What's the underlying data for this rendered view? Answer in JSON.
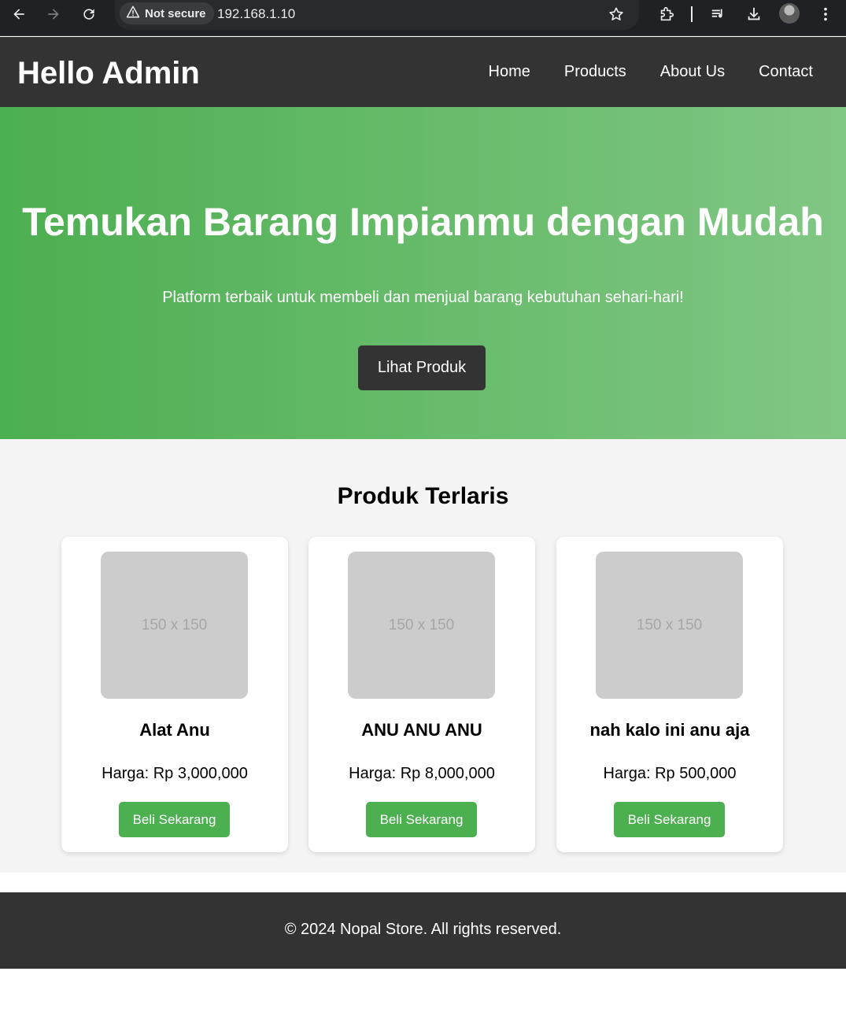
{
  "browser": {
    "security_label": "Not secure",
    "url": "192.168.1.10",
    "icons": [
      "back-arrow-icon",
      "forward-arrow-icon",
      "reload-icon",
      "warning-icon",
      "bookmark-star-icon",
      "extensions-icon",
      "media-playlist-icon",
      "download-icon",
      "profile-avatar",
      "more-vert-icon"
    ]
  },
  "header": {
    "brand": "Hello Admin",
    "nav": [
      "Home",
      "Products",
      "About Us",
      "Contact"
    ]
  },
  "hero": {
    "title": "Temukan Barang Impianmu dengan Mudah",
    "subtitle": "Platform terbaik untuk membeli dan menjual barang kebutuhan sehari-hari!",
    "cta_label": "Lihat Produk"
  },
  "products": {
    "heading": "Produk Terlaris",
    "items": [
      {
        "placeholder": "150 x 150",
        "name": "Alat Anu",
        "price": "Harga: Rp 3,000,000",
        "button": "Beli Sekarang"
      },
      {
        "placeholder": "150 x 150",
        "name": "ANU ANU ANU",
        "price": "Harga: Rp 8,000,000",
        "button": "Beli Sekarang"
      },
      {
        "placeholder": "150 x 150",
        "name": "nah kalo ini anu aja",
        "price": "Harga: Rp 500,000",
        "button": "Beli Sekarang"
      }
    ]
  },
  "footer": {
    "copyright": "© 2024 Nopal Store. All rights reserved."
  },
  "colors": {
    "header_bg": "#333333",
    "accent_green": "#4caf50",
    "accent_green_light": "#81c784",
    "section_bg": "#f4f4f4",
    "placeholder_bg": "#cccccc"
  }
}
